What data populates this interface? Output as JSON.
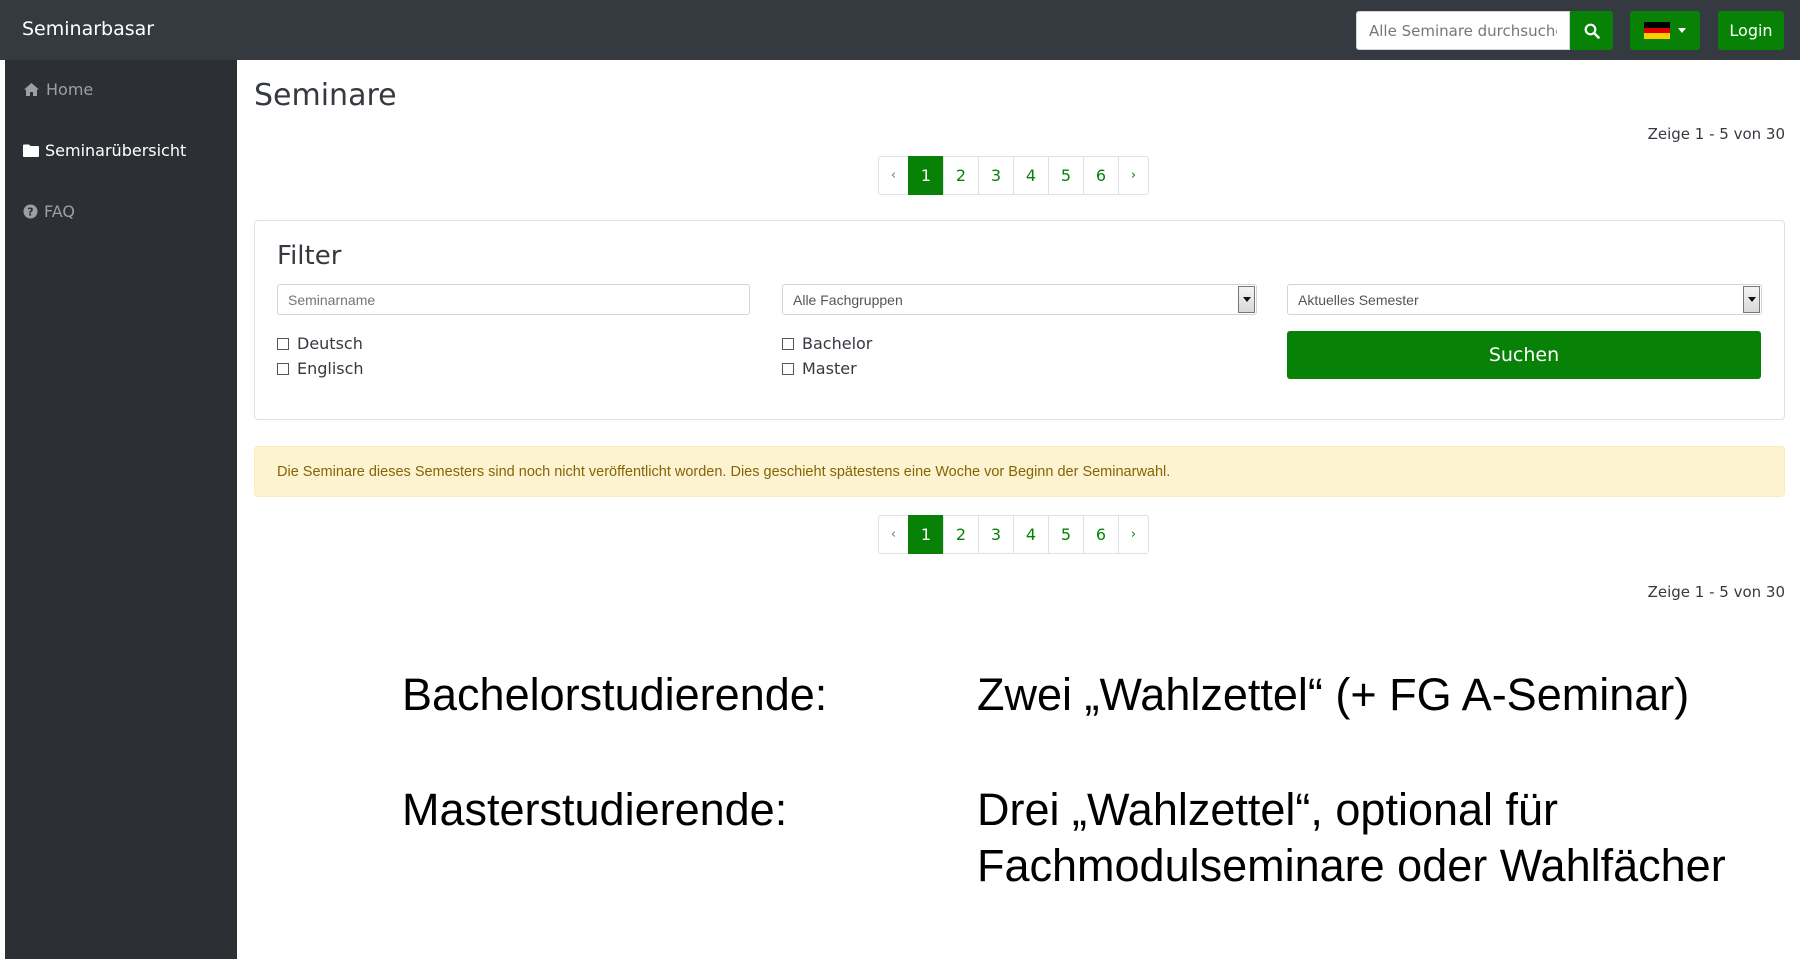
{
  "navbar": {
    "brand": "Seminarbasar",
    "search_placeholder": "Alle Seminare durchsuchen",
    "login_label": "Login"
  },
  "sidebar": {
    "items": [
      {
        "icon": "home-icon",
        "label": "Home"
      },
      {
        "icon": "folder-icon",
        "label": "Seminarübersicht"
      },
      {
        "icon": "question-circle-icon",
        "label": "FAQ"
      }
    ]
  },
  "main": {
    "title": "Seminare",
    "count_text": "Zeige 1 - 5 von 30",
    "pagination": {
      "prev": "‹",
      "next": "›",
      "pages": [
        "1",
        "2",
        "3",
        "4",
        "5",
        "6"
      ],
      "current": "1"
    },
    "filter": {
      "title": "Filter",
      "name_placeholder": "Seminarname",
      "fachgruppe_value": "Alle Fachgruppen",
      "semester_value": "Aktuelles Semester",
      "languages": [
        "Deutsch",
        "Englisch"
      ],
      "degrees": [
        "Bachelor",
        "Master"
      ],
      "submit_label": "Suchen"
    },
    "alert": "Die Seminare dieses Semesters sind noch nicht veröffentlicht worden. Dies geschieht spätestens eine Woche vor Beginn der Seminarwahl."
  },
  "overlay": {
    "bachelor_label": "Bachelorstudierende:",
    "bachelor_text": "Zwei „Wahlzettel“ (+ FG A-Seminar)",
    "master_label": "Masterstudierende:",
    "master_text_line1": "Drei „Wahlzettel“, optional für",
    "master_text_line2": "Fachmodulseminare oder Wahlfächer"
  },
  "colors": {
    "navbar_bg": "#343a40",
    "sidebar_bg": "#2c3034",
    "accent_green": "#078207",
    "alert_bg": "#fdf3d1",
    "alert_text": "#856404"
  }
}
